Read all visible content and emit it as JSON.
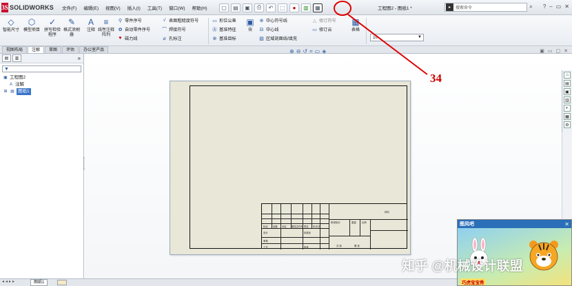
{
  "app": {
    "logo_letters": "3S",
    "logo_text": "SOLIDWORKS",
    "document_title": "工程图2 - 图纸1 *"
  },
  "menu": [
    "文件(F)",
    "编辑(E)",
    "视图(V)",
    "插入(I)",
    "工具(T)",
    "窗口(W)",
    "帮助(H)"
  ],
  "search": {
    "placeholder": "搜索命令"
  },
  "ribbon": {
    "smart_dimension": "智能尺寸",
    "model_items": "模型项目",
    "spell_check": "拼写检验程序",
    "format_painter": "格式涂刷器",
    "note": "注释",
    "linear_note_pattern": "线性注释阵列",
    "balloon": "零件序号",
    "auto_balloon": "自动零件序号",
    "magnetic_line": "磁力线",
    "surface_finish": "表面粗糙度符号",
    "weld_symbol": "焊接符号",
    "hole_callout": "孔标注",
    "gdt": "形位公差",
    "datum_feature": "基准特征",
    "datum_target": "基准目标",
    "block": "块",
    "center_mark": "中心符号线",
    "centerline": "中心线",
    "area_hatch": "区域剖面线/填充",
    "revision_symbol": "修订符号",
    "revision_cloud": "修订云",
    "table": "表格",
    "layer_value": "10"
  },
  "tabs": [
    "视图布局",
    "注解",
    "草图",
    "评估",
    "办公室产品"
  ],
  "active_tab_index": 1,
  "tree": {
    "root": "工程图2",
    "annotations": "注解",
    "sheet": "图纸1"
  },
  "title_block_labels": {
    "mark": "标记",
    "count": "处数",
    "zone": "分区",
    "change_doc": "更改文件号",
    "signature": "签名",
    "date": "年月日",
    "design": "设计",
    "standardization": "标准化",
    "stage_mark": "阶段标记",
    "weight": "重量",
    "scale": "比例",
    "review": "审核",
    "process": "工艺",
    "approve": "批准",
    "sheets_total": "共 张",
    "sheet_no": "第 张",
    "material": "材料"
  },
  "bottom": {
    "sheet_tab": "图纸1"
  },
  "ad": {
    "header": "图风吧",
    "caption": "巧虎宝宝秀"
  },
  "watermark": "知乎 @机械设计联盟",
  "annotation_number": "34",
  "colors": {
    "accent": "#c00000",
    "selection": "#3874c8",
    "sheet_bg": "#e9e7d8"
  }
}
